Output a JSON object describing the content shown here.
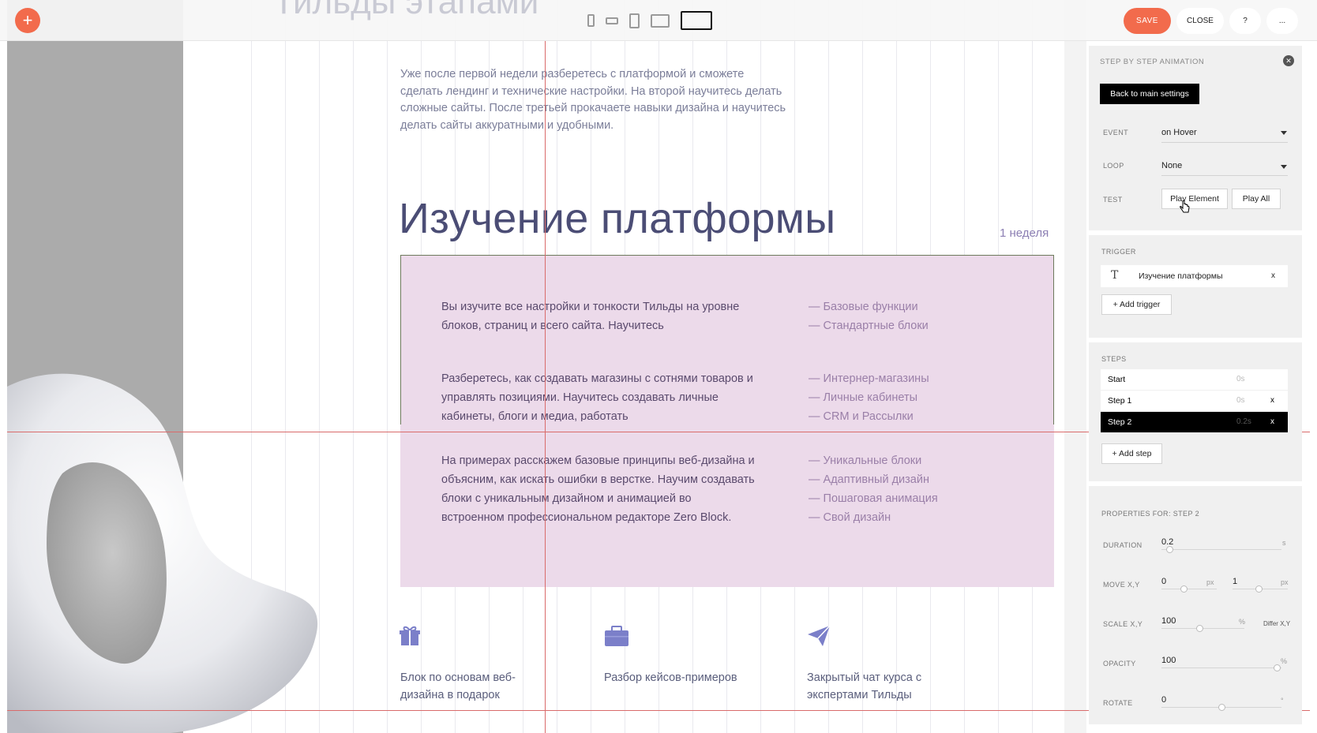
{
  "toolbar": {
    "plus_label": "+",
    "ghost_heading": "Тильды этапами",
    "devices": [
      "phone-portrait",
      "phone-landscape",
      "tablet-portrait",
      "tablet-landscape",
      "desktop"
    ],
    "save_label": "SAVE",
    "close_label": "CLOSE",
    "help_label": "?",
    "more_label": "..."
  },
  "content": {
    "intro": "Уже после первой недели разберетесь с платформой и сможете сделать лендинг и технические настройки. На второй научитесь делать сложные сайты. После третьей прокачаете навыки дизайна и научитесь делать сайты аккуратными и удобными.",
    "heading": "Изучение платформы",
    "week": "1 неделя",
    "blocks": [
      {
        "text": "Вы изучите все настройки и тонкости Тильды на уровне блоков, страниц и всего сайта. Научитесь",
        "list": [
          "— Базовые функции",
          "— Стандартные блоки"
        ]
      },
      {
        "text": "Разберетесь, как создавать магазины с сотнями товаров и управлять позициями. Научитесь создавать личные кабинеты, блоги и медиа, работать",
        "list": [
          "— Интернер-магазины",
          "— Личные кабинеты",
          "— CRM и Рассылки"
        ]
      },
      {
        "text": "На примерах расскажем базовые принципы веб-дизайна и объясним, как искать ошибки в верстке. Научим создавать блоки с уникальным дизайном и анимацией во встроенном профессиональном редакторе Zero Block.",
        "list": [
          "— Уникальные блоки",
          "— Адаптивный дизайн",
          "— Пошаговая анимация",
          "— Свой дизайн"
        ]
      }
    ],
    "features": [
      {
        "icon": "gift-icon",
        "text": "Блок по основам веб-дизайна в подарок"
      },
      {
        "icon": "briefcase-icon",
        "text": "Разбор кейсов-примеров"
      },
      {
        "icon": "paper-plane-icon",
        "text": "Закрытый чат курса с экспертами Тильды"
      }
    ],
    "accent_color": "#7b7fc9"
  },
  "panel": {
    "title": "STEP BY STEP ANIMATION",
    "back_label": "Back to main settings",
    "event_label": "EVENT",
    "event_value": "on Hover",
    "loop_label": "LOOP",
    "loop_value": "None",
    "test_label": "TEST",
    "play_element": "Play Element",
    "play_all": "Play All",
    "trigger_label": "TRIGGER",
    "trigger_item": "Изучение платформы",
    "trigger_remove": "x",
    "add_trigger": "+ Add trigger",
    "steps_label": "STEPS",
    "steps": [
      {
        "name": "Start",
        "time": "0s",
        "remove": ""
      },
      {
        "name": "Step 1",
        "time": "0s",
        "remove": "x"
      },
      {
        "name": "Step 2",
        "time": "0.2s",
        "remove": "x"
      }
    ],
    "add_step": "+ Add step",
    "props_label": "PROPERTIES FOR: STEP 2",
    "duration_label": "DURATION",
    "duration_value": "0.2",
    "duration_unit": "s",
    "move_label": "MOVE X,Y",
    "move_x": "0",
    "move_y": "1",
    "move_unit": "px",
    "scale_label": "SCALE X,Y",
    "scale_value": "100",
    "scale_unit": "%",
    "differ_label": "Differ X,Y",
    "opacity_label": "OPACITY",
    "opacity_value": "100",
    "opacity_unit": "%",
    "rotate_label": "ROTATE",
    "rotate_value": "0",
    "rotate_unit": "°"
  }
}
